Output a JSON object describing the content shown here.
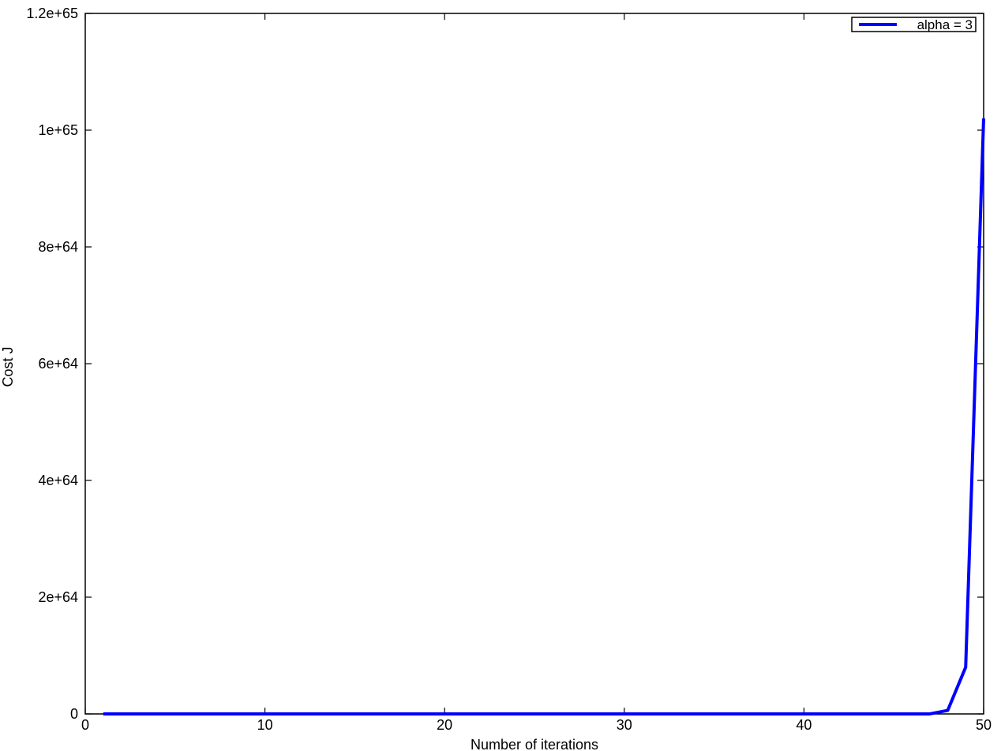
{
  "chart_data": {
    "type": "line",
    "title": "",
    "xlabel": "Number of iterations",
    "ylabel": "Cost J",
    "xlim": [
      0,
      50
    ],
    "ylim": [
      0,
      1.2e+65
    ],
    "xticks": [
      0,
      10,
      20,
      30,
      40,
      50
    ],
    "xtick_labels": [
      "0",
      "10",
      "20",
      "30",
      "40",
      "50"
    ],
    "yticks": [
      0,
      2e+64,
      4e+64,
      6e+64,
      8e+64,
      1e+65,
      1.2e+65
    ],
    "ytick_labels": [
      "0",
      "2e+64",
      "4e+64",
      "6e+64",
      "8e+64",
      "1e+65",
      "1.2e+65"
    ],
    "grid": false,
    "legend_position": "top-right",
    "series": [
      {
        "name": "alpha = 3",
        "color": "#0000ff",
        "x": [
          1,
          2,
          3,
          4,
          5,
          6,
          7,
          8,
          9,
          10,
          11,
          12,
          13,
          14,
          15,
          16,
          17,
          18,
          19,
          20,
          21,
          22,
          23,
          24,
          25,
          26,
          27,
          28,
          29,
          30,
          31,
          32,
          33,
          34,
          35,
          36,
          37,
          38,
          39,
          40,
          41,
          42,
          43,
          44,
          45,
          46,
          47,
          48,
          49,
          50
        ],
        "y": [
          0,
          0,
          0,
          0,
          0,
          0,
          0,
          0,
          0,
          0,
          0,
          0,
          0,
          0,
          0,
          0,
          0,
          0,
          0,
          0,
          0,
          0,
          0,
          0,
          0,
          0,
          0,
          0,
          0,
          0,
          0,
          0,
          0,
          0,
          0,
          0,
          0,
          0,
          0,
          0,
          0,
          0,
          0,
          0,
          1e+57,
          1e+59,
          8e+60,
          6e+62,
          8e+63,
          1.02e+65
        ]
      }
    ]
  }
}
